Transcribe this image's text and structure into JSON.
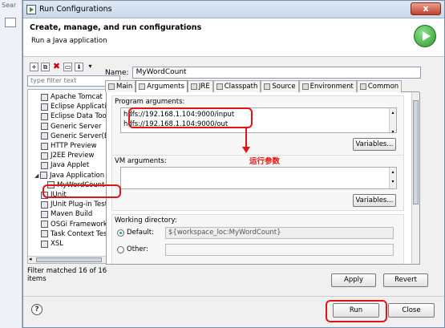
{
  "outer": {
    "search_text": "Sear"
  },
  "window": {
    "title": "Run Configurations",
    "close_glyph": "x"
  },
  "header": {
    "title": "Create, manage, and run configurations",
    "subtitle": "Run a Java application"
  },
  "left": {
    "filter_placeholder": "type filter text",
    "items": [
      {
        "label": "Apache Tomcat",
        "icon": "tomcat-icon"
      },
      {
        "label": "Eclipse Application",
        "icon": "eclipse-icon"
      },
      {
        "label": "Eclipse Data Tools",
        "icon": "data-tools-icon"
      },
      {
        "label": "Generic Server",
        "icon": "server-icon"
      },
      {
        "label": "Generic Server(Extern",
        "icon": "server-icon"
      },
      {
        "label": "HTTP Preview",
        "icon": "preview-icon"
      },
      {
        "label": "J2EE Preview",
        "icon": "preview-icon"
      },
      {
        "label": "Java Applet",
        "icon": "applet-icon"
      },
      {
        "label": "Java Application",
        "icon": "java-app-icon"
      },
      {
        "label": "MyWordCount",
        "icon": "java-class-icon"
      },
      {
        "label": "JUnit",
        "icon": "junit-icon"
      },
      {
        "label": "JUnit Plug-in Test",
        "icon": "junit-icon"
      },
      {
        "label": "Maven Build",
        "icon": "maven-icon"
      },
      {
        "label": "OSGi Framework",
        "icon": "osgi-icon"
      },
      {
        "label": "Task Context Test",
        "icon": "task-icon"
      },
      {
        "label": "XSL",
        "icon": "xsl-icon"
      }
    ],
    "status": "Filter matched 16 of 16 items"
  },
  "config": {
    "name_label": "Name:",
    "name_value": "MyWordCount",
    "tabs": [
      "Main",
      "Arguments",
      "JRE",
      "Classpath",
      "Source",
      "Environment",
      "Common"
    ],
    "active_tab": "Arguments",
    "program_args_label": "Program arguments:",
    "program_args": [
      "hdfs://192.168.1.104:9000/input",
      "hdfs://192.168.1.104:9000/out"
    ],
    "variables_label": "Variables...",
    "vm_args_label": "VM arguments:",
    "vm_variables_label": "Variables...",
    "working_dir_label": "Working directory:",
    "default_label": "Default:",
    "default_value": "${workspace_loc:MyWordCount}",
    "other_label": "Other:"
  },
  "annotation": {
    "text": "运行参数",
    "color": "#e31313"
  },
  "buttons": {
    "apply": "Apply",
    "revert": "Revert",
    "run": "Run",
    "close": "Close",
    "help": "?"
  }
}
